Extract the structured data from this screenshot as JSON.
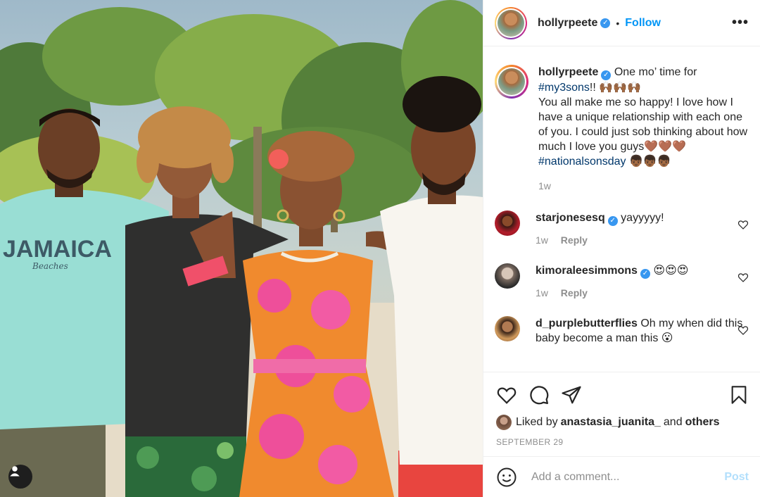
{
  "post": {
    "username": "hollyrpeete",
    "follow_label": "Follow",
    "separator": "•",
    "more_label": "•••"
  },
  "caption": {
    "username": "hollyrpeete",
    "text1": "One mo’ time for",
    "hashtag1": "#my3sons",
    "text2": "!! 🙌🏾🙌🏾🙌🏾",
    "text3": "You all make me so happy! I love how I have a unique relationship with each one of you. I could just sob thinking about how much I love you guys🤎🤎🤎",
    "hashtag2": "#nationalsonsday",
    "emoji_tail": " 👦🏾👦🏾👦🏾",
    "time": "1w"
  },
  "comments": [
    {
      "username": "starjonesesq",
      "verified": true,
      "text": "yayyyyy!",
      "time": "1w",
      "reply": "Reply"
    },
    {
      "username": "kimoraleesimmons",
      "verified": true,
      "text": "😍😍😍",
      "time": "1w",
      "reply": "Reply"
    },
    {
      "username": "d_purplebutterflies",
      "verified": false,
      "text": "Oh my when did this baby become a man this 😮",
      "time": "",
      "reply": ""
    }
  ],
  "likes": {
    "prefix": "Liked by ",
    "user": "anastasia_juanita_",
    "middle": " and ",
    "others": "others"
  },
  "date": "SEPTEMBER 29",
  "add_comment": {
    "placeholder": "Add a comment...",
    "post_label": "Post"
  },
  "photo": {
    "shirt_text": "JAMAICA",
    "shirt_subtext": "Beaches"
  },
  "colors": {
    "accent": "#0095f6",
    "verified": "#3897f0",
    "hashtag": "#00376b",
    "post_disabled": "#b2dffc"
  }
}
